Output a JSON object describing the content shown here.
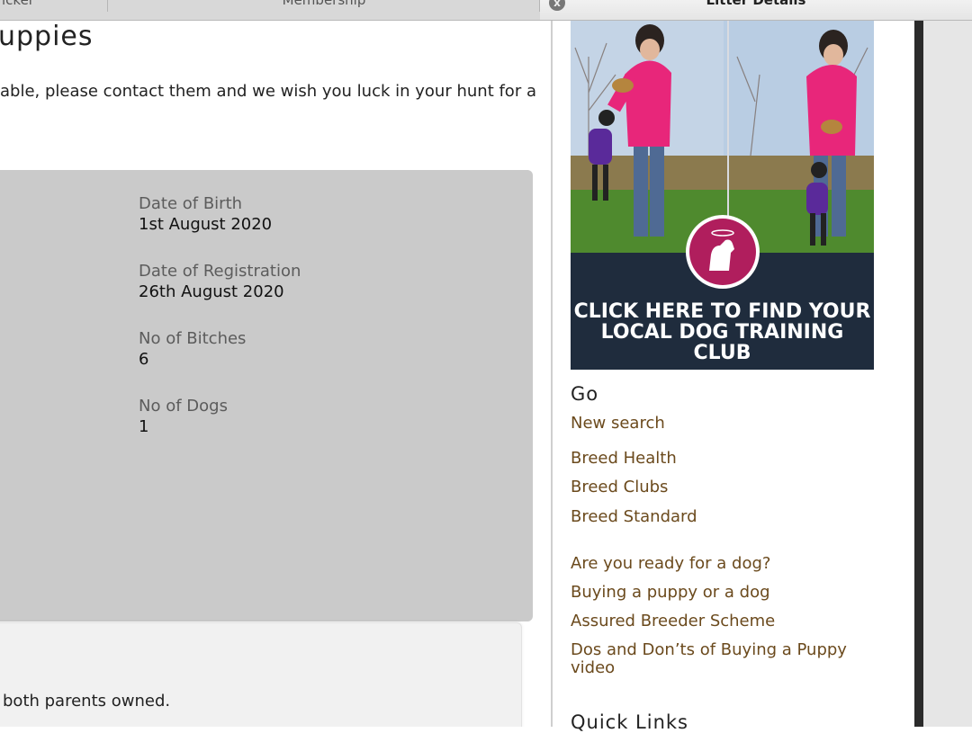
{
  "tabs": [
    {
      "label": "icker"
    },
    {
      "label": "Membership"
    },
    {
      "label": "Litter Details",
      "close_icon": "x"
    }
  ],
  "main": {
    "title": "uppies",
    "intro": "able, please contact them and we wish you luck in your hunt for a",
    "fields": [
      {
        "label": "Date of Birth",
        "value": "1st August 2020"
      },
      {
        "label": "Date of Registration",
        "value": "26th August 2020"
      },
      {
        "label": "No of Bitches",
        "value": "6"
      },
      {
        "label": "No of Dogs",
        "value": "1"
      }
    ],
    "note": "both parents owned."
  },
  "sidebar": {
    "banner_text": [
      "CLICK HERE TO FIND YOUR",
      "LOCAL DOG TRAINING CLUB"
    ],
    "go_heading": "Go",
    "links": [
      "New search",
      "Breed Health",
      "Breed Clubs",
      "Breed Standard",
      "Are you ready for a dog?",
      "Buying a puppy or a dog",
      "Assured Breeder Scheme",
      "Dos and Don’ts of Buying a Puppy",
      "video"
    ],
    "quick_heading": "Quick Links"
  },
  "colors": {
    "link": "#6b4a1d",
    "card": "#cacaca",
    "banner_bg": "#1f2c3d",
    "jacket": "#e8267a",
    "logo": "#b01e5d"
  }
}
